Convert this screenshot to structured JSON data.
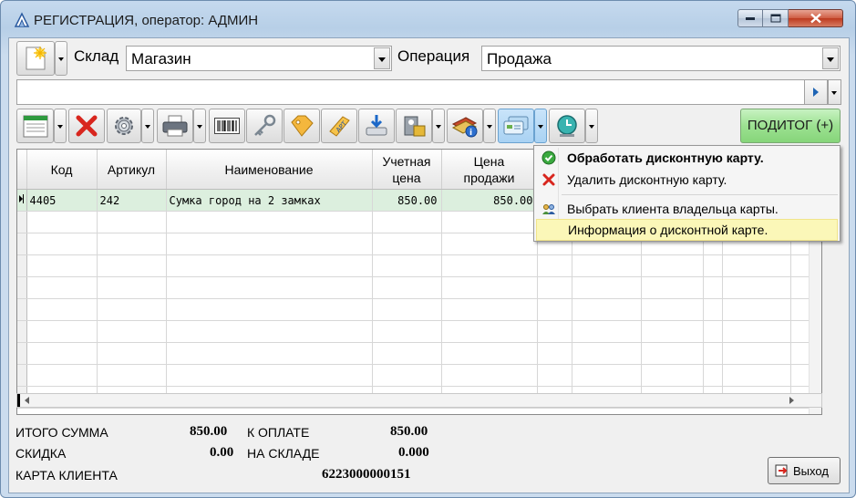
{
  "window": {
    "title": "РЕГИСТРАЦИЯ, оператор: АДМИН"
  },
  "header": {
    "sklad_label": "Склад",
    "sklad_value": "Магазин",
    "operation_label": "Операция",
    "operation_value": "Продажа"
  },
  "search": {
    "value": ""
  },
  "toolbar": {
    "poditog_label": "ПОДИТОГ (+)"
  },
  "grid": {
    "columns": [
      "Код",
      "Артикул",
      "Наименование",
      "Учетная цена",
      "Цена продажи"
    ],
    "column_lines": [
      [
        "Код"
      ],
      [
        "Артикул"
      ],
      [
        "Наименование"
      ],
      [
        "Учетная",
        "цена"
      ],
      [
        "Цена",
        "продажи"
      ]
    ],
    "rows": [
      {
        "code": "4405",
        "article": "242",
        "name": "Сумка город на 2 замках",
        "account_price": "850.00",
        "sale_price": "850.00"
      }
    ]
  },
  "menu": {
    "items": [
      {
        "label": "Обработать дисконтную карту.",
        "icon": "check-icon"
      },
      {
        "label": "Удалить дисконтную карту.",
        "icon": "delete-icon"
      },
      {
        "label": "Выбрать клиента владельца карты.",
        "icon": "people-icon"
      },
      {
        "label": "Информация о дисконтной карте.",
        "icon": ""
      }
    ]
  },
  "totals": {
    "total_sum_label": "ИТОГО СУММА",
    "total_sum_value": "850.00",
    "to_pay_label": "К ОПЛАТЕ",
    "to_pay_value": "850.00",
    "discount_label": "СКИДКА",
    "discount_value": "0.00",
    "in_stock_label": "НА СКЛАДЕ",
    "in_stock_value": "0.000",
    "client_card_label": "КАРТА КЛИЕНТА",
    "client_card_value": "6223000000151"
  },
  "footer": {
    "exit_label": "Выход"
  }
}
